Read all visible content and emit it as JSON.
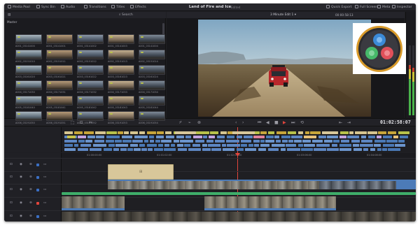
{
  "toolbar": {
    "media_pool": "Media Pool",
    "sync_bin": "Sync Bin",
    "audio": "Audio",
    "transitions": "Transitions",
    "titles": "Titles",
    "effects": "Effects",
    "project_title": "Land of Fire and Ice",
    "project_status": "Edited",
    "quick_export": "Quick Export",
    "full_screen": "Full Screen",
    "meta": "Meta",
    "inspector": "Inspector"
  },
  "media_pool": {
    "label": "Master",
    "search_label": "Search",
    "clip_names": [
      "A001_03141000",
      "A001_03141001",
      "A001_03141002",
      "A001_03141003",
      "A001_03141004",
      "A002_03151010",
      "A002_03151011",
      "A002_03151012",
      "A002_03151013",
      "A002_03151014",
      "A003_03161020",
      "A003_03161021",
      "A003_03161022",
      "A003_03161023",
      "A003_03161024",
      "A004_03171030",
      "A004_03171031",
      "A004_03171032",
      "A004_03171033",
      "A004_03171034",
      "A005_03181040",
      "A005_03181041",
      "A005_03181042",
      "A005_03181043",
      "A005_03181044",
      "A006_03191050",
      "A006_03191051",
      "A006_03191052",
      "A006_03191053",
      "A006_03191054"
    ]
  },
  "viewer": {
    "timeline_name": "3 Minute Edit 1",
    "timecode_header": "00:00:58:13"
  },
  "transport": {
    "timecode": "01:02:58:07",
    "colors": {
      "stop_red": "#e2453c"
    }
  },
  "timeline": {
    "ruler_labels": [
      "01:00:00:00",
      "01:01:02:00",
      "01:02:04:00",
      "01:03:06:00",
      "01:04:08:00"
    ]
  },
  "colors": {
    "playhead": "#e2453c",
    "video_clip": "#4c7bb8",
    "audio_clip": "#3fae6a",
    "title_clip": "#d8c79a"
  }
}
